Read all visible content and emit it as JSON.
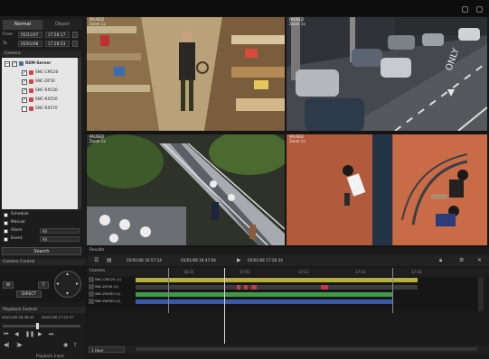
{
  "tabs": {
    "normal": "Normal",
    "object": "Object"
  },
  "search_range": {
    "from_label": "From",
    "from_date": "05/21/07",
    "from_time": "17:28:17",
    "to_label": "To",
    "to_date": "05/01/08",
    "to_time": "17:28:53"
  },
  "camera_panel": {
    "header": "Camera",
    "server": "RSM-Server",
    "cameras": [
      {
        "label": "SNC-CM120",
        "checked": true
      },
      {
        "label": "SNC-DF50",
        "checked": true
      },
      {
        "label": "SNC-RX530",
        "checked": true
      },
      {
        "label": "SNC-RX550",
        "checked": true
      },
      {
        "label": "SNC-RX570",
        "checked": false
      }
    ]
  },
  "filters": {
    "schedule": "Schedule",
    "manual": "Manual",
    "alarm": "Alarm",
    "event": "Event",
    "alarm_value": "All",
    "event_value": "All"
  },
  "search_button": "Search",
  "camera_control": {
    "header": "Camera Control",
    "w": "W",
    "t": "T",
    "direct": "DIRECT"
  },
  "playback": {
    "header": "Playback Control",
    "start_time": "05/01/08 16:36:45",
    "end_time": "05/01/08 17:22:37",
    "bottom_label": "Playback Input"
  },
  "videos": [
    {
      "line1": "PAUSED",
      "line2": "Zoom 1x",
      "scene": "store"
    },
    {
      "line1": "PAUSED",
      "line2": "Zoom 1x",
      "scene": "street"
    },
    {
      "line1": "PAUSED",
      "line2": "Zoom 1x",
      "scene": "escalator"
    },
    {
      "line1": "PAUSED",
      "line2": "Zoom 1x",
      "scene": "overhead"
    }
  ],
  "results": {
    "header": "Results",
    "time_start": "05/01/08 16:57:24",
    "time_cursor": "05/01/08 16:47:04",
    "time_end": "05/01/08 17:26:34",
    "camera_header": "Camera",
    "tick_labels": [
      "16:51",
      "17:01",
      "17:11",
      "17:21",
      "17:31"
    ],
    "tracks": [
      {
        "label": "SNC-CM120 (1)",
        "color": "#b7ad3c"
      },
      {
        "label": "SNC-DF50 (1)",
        "color": "#c23b4a"
      },
      {
        "label": "SNC-RX530 (1)",
        "color": "#3f9a45"
      },
      {
        "label": "SNC-RX550 (1)",
        "color": "#3a57a8"
      }
    ],
    "zoom_value": "1 Hour"
  },
  "icons": [
    "camera-icon",
    "settings-icon",
    "grid-icon",
    "play-icon",
    "lock-icon",
    "close-icon"
  ]
}
